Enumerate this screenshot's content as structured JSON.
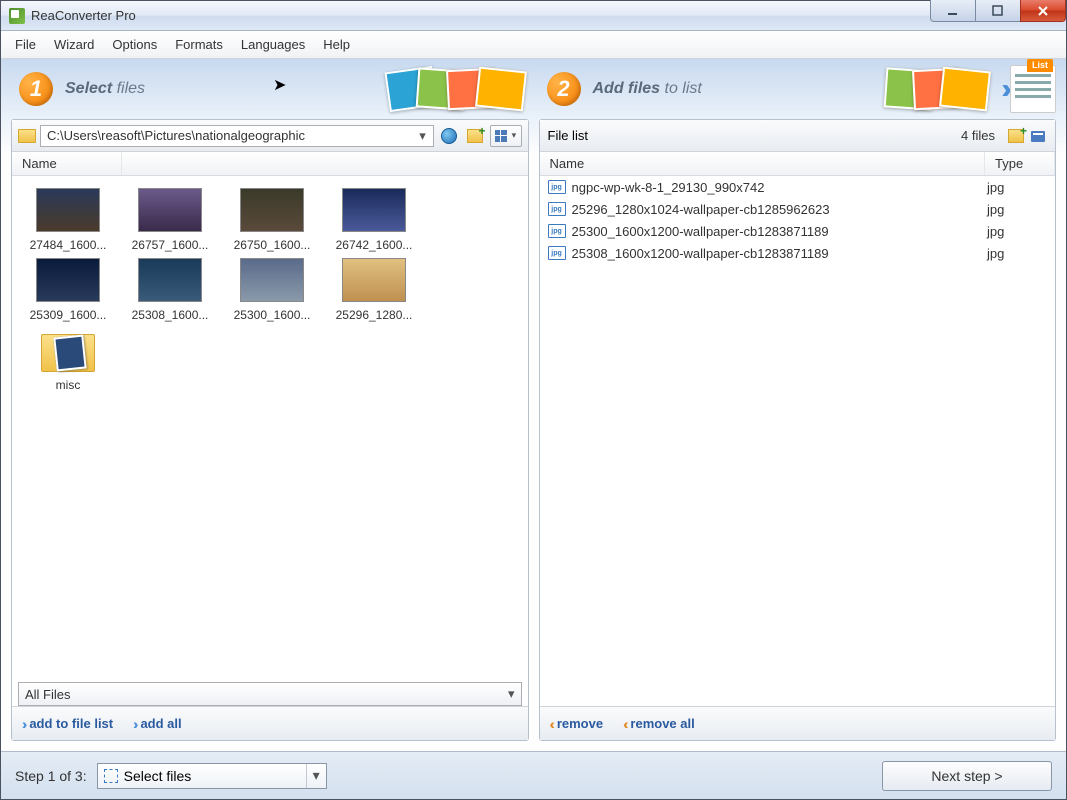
{
  "window": {
    "title": "ReaConverter Pro"
  },
  "menu": [
    "File",
    "Wizard",
    "Options",
    "Formats",
    "Languages",
    "Help"
  ],
  "panel1": {
    "badge": "1",
    "title_bold": "Select",
    "title_light": "files"
  },
  "panel2": {
    "badge": "2",
    "title_bold": "Add files",
    "title_light": "to list",
    "list_tab": "List"
  },
  "browser": {
    "path": "C:\\Users\\reasoft\\Pictures\\nationalgeographic",
    "col_name": "Name",
    "filter": "All Files",
    "thumbs": [
      {
        "label": "27484_1600...",
        "cls": "t1"
      },
      {
        "label": "26757_1600...",
        "cls": "t2"
      },
      {
        "label": "26750_1600...",
        "cls": "t3"
      },
      {
        "label": "26742_1600...",
        "cls": "t4"
      },
      {
        "label": "25309_1600...",
        "cls": "t5"
      },
      {
        "label": "25308_1600...",
        "cls": "t6"
      },
      {
        "label": "25300_1600...",
        "cls": "t7"
      },
      {
        "label": "25296_1280...",
        "cls": "t8"
      }
    ],
    "folder_label": "misc",
    "add_one": "add to file list",
    "add_all": "add all"
  },
  "filelist": {
    "header": "File list",
    "count": "4 files",
    "col_name": "Name",
    "col_type": "Type",
    "rows": [
      {
        "name": "ngpc-wp-wk-8-1_29130_990x742",
        "type": "jpg"
      },
      {
        "name": "25296_1280x1024-wallpaper-cb1285962623",
        "type": "jpg"
      },
      {
        "name": "25300_1600x1200-wallpaper-cb1283871189",
        "type": "jpg"
      },
      {
        "name": "25308_1600x1200-wallpaper-cb1283871189",
        "type": "jpg"
      }
    ],
    "remove": "remove",
    "remove_all": "remove all"
  },
  "footer": {
    "step_label": "Step 1 of 3:",
    "step_value": "Select files",
    "next": "Next step >"
  }
}
